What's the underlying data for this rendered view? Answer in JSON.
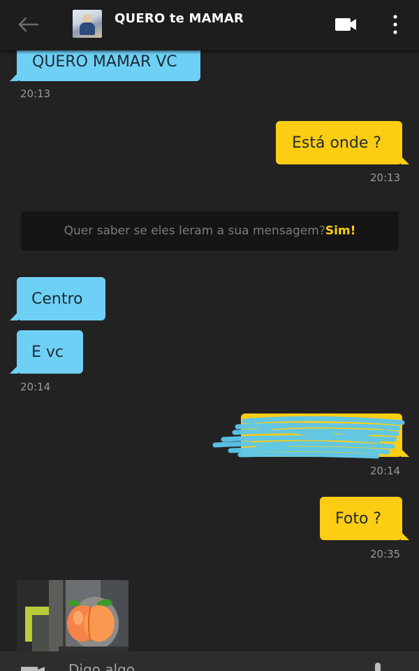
{
  "header": {
    "title": "QUERO te MAMAR",
    "back_icon": "arrow-left-icon",
    "video_icon": "video-camera-icon",
    "menu_icon": "vertical-dots-icon"
  },
  "messages": [
    {
      "direction": "in",
      "text": "QUERO MAMAR VC",
      "time": "20:13"
    },
    {
      "direction": "out",
      "text": "Está onde ?",
      "time": "20:13"
    },
    {
      "direction": "in",
      "text": "Centro"
    },
    {
      "direction": "in",
      "text": "E vc",
      "time": "20:14"
    },
    {
      "direction": "out",
      "text": "",
      "redacted": true,
      "time": "20:14"
    },
    {
      "direction": "out",
      "text": "Foto ?",
      "time": "20:35"
    }
  ],
  "notice": {
    "text": "Quer saber se eles leram a sua mensagem?",
    "action": "Sim!"
  },
  "photo": {
    "overlay_icon": "peach-emoji-icon"
  },
  "composer": {
    "placeholder": "Digo algo...",
    "camera_icon": "camera-icon",
    "mic_icon": "microphone-icon"
  },
  "colors": {
    "incoming_bubble": "#6fd0f6",
    "outgoing_bubble": "#fdcd14",
    "background": "#222222",
    "accent": "#fdcd14"
  }
}
